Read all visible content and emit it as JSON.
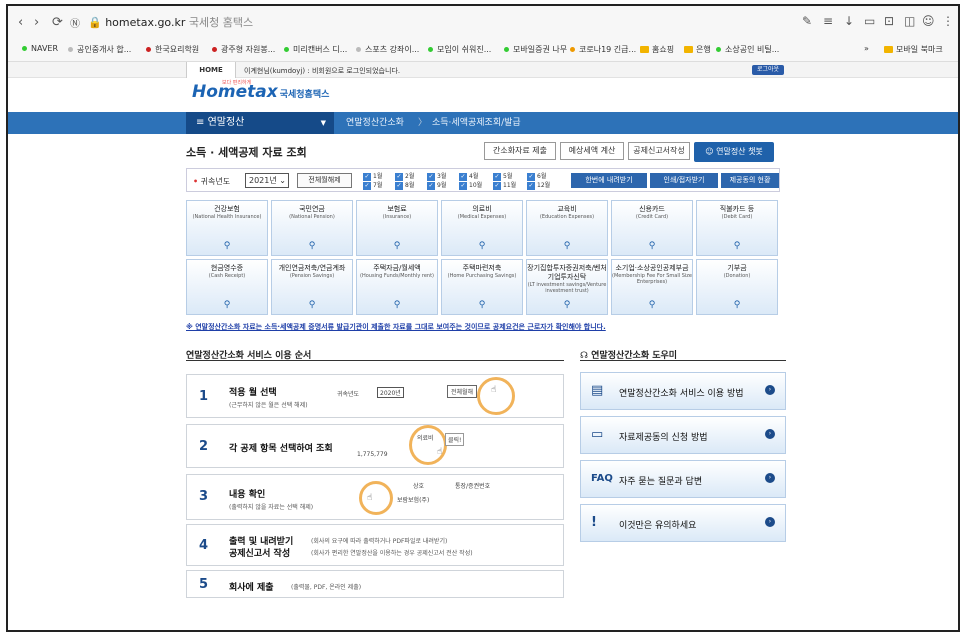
{
  "browser": {
    "url_domain": "hometax.go.kr",
    "url_title": "국세청 홈택스",
    "bookmarks": [
      "NAVER",
      "공인중개사 합...",
      "한국요리학원",
      "광주형 자원봉...",
      "미리캔버스 디...",
      "스포츠 강좌이...",
      "모임이 쉬워진...",
      "모바일증권 나무",
      "코로나19 긴급...",
      "홈쇼핑",
      "은행",
      "소상공인 비틸..."
    ],
    "bookmark_more": "»",
    "mobile_bookmarks": "모바일 북마크"
  },
  "site": {
    "home": "HOME",
    "greeting": "이계현님(kumdoyj) : 비회원으로 로그인되었습니다.",
    "logout": "로그아웃",
    "logo": "Hometax",
    "logo_sub": "국세청홈택스",
    "logo_small": "보다 편리하게"
  },
  "menu": {
    "main": "연말정산",
    "items": [
      "연말정산간소화",
      "소득·세액공제조회/발급"
    ]
  },
  "title": "소득 · 세액공제 자료 조회",
  "top_buttons": [
    "간소화자료 제출",
    "예상세액 계산",
    "공제신고서작성"
  ],
  "chat_button": "연말정산 챗봇",
  "year_bar": {
    "label": "귀속년도",
    "year": "2021년",
    "toggle": "전체월해제",
    "months": [
      "1월",
      "2월",
      "3월",
      "4월",
      "5월",
      "6월",
      "7월",
      "8월",
      "9월",
      "10월",
      "11월",
      "12월"
    ],
    "buttons": [
      "한번에 내려받기",
      "인쇄/접자받기",
      "제공동의 현황"
    ]
  },
  "categories": [
    {
      "name": "건강보험",
      "en": "(National Health Insurance)"
    },
    {
      "name": "국민연금",
      "en": "(National Pension)"
    },
    {
      "name": "보험료",
      "en": "(Insurance)"
    },
    {
      "name": "의료비",
      "en": "(Medical Expenses)"
    },
    {
      "name": "교육비",
      "en": "(Education Expenses)"
    },
    {
      "name": "신용카드",
      "en": "(Credit Card)"
    },
    {
      "name": "직불카드 등",
      "en": "(Debit Card)"
    },
    {
      "name": "현금영수증",
      "en": "(Cash Receipt)"
    },
    {
      "name": "개인연금저축/연금계좌",
      "en": "(Pension Savings)"
    },
    {
      "name": "주택자금/월세액",
      "en": "(Housing Funds/Monthly rent)"
    },
    {
      "name": "주택마련저축",
      "en": "(Home Purchasing Savings)"
    },
    {
      "name": "장기집합투자증권저축/벤처기업투자신탁",
      "en": "(LT investment savings/Venture investment trust)"
    },
    {
      "name": "소기업·소상공인공제부금",
      "en": "(Membership Fee For Small Size Enterprises)"
    },
    {
      "name": "기부금",
      "en": "(Donation)"
    }
  ],
  "notice": "※ 연말정산간소화 자료는 소득·세액공제 증명서류 발급기관이 제출한 자료를 그대로 보여주는 것이므로 공제요건은 근로자가 확인해야 합니다.",
  "usage_title": "연말정산간소화 서비스 이용 순서",
  "steps": [
    {
      "n": "1",
      "title": "적용 월 선택",
      "sub": "(근무하지 않은 월은 선택 해제)"
    },
    {
      "n": "2",
      "title": "각 공제 항목 선택하여 조회",
      "sub": ""
    },
    {
      "n": "3",
      "title": "내용 확인",
      "sub": "(출력하지 않을 자료는 선택 해제)"
    },
    {
      "n": "4",
      "title": "출력 및 내려받기",
      "title2": "공제신고서 작성",
      "sub": "(회사의 요구에 따라 출력하거나 PDF파일로 내려받기)",
      "sub2": "(회사가 편리한 연말정산을 이용하는 경우 공제신고서 전산 작성)"
    },
    {
      "n": "5",
      "title": "회사에 제출",
      "sub": "(출력물, PDF, 온라인 제출)"
    }
  ],
  "step_thumbs": {
    "year_label": "귀속년도",
    "year": "2020년",
    "toggle": "전체월해",
    "medical": "의료비",
    "click": "클릭!",
    "amount": "1,775,779",
    "hdr1": "상호",
    "hdr2": "통장/증권번호",
    "row": "보람보험(주)"
  },
  "helper_title": "연말정산간소화 도우미",
  "helpers": [
    {
      "icon": "document-icon",
      "label": "연말정산간소화 서비스 이용 방법"
    },
    {
      "icon": "consent-icon",
      "label": "자료제공동의 신청 방법"
    },
    {
      "icon": "faq-icon",
      "label": "자주 묻는 질문과 답변"
    },
    {
      "icon": "caution-icon",
      "label": "이것만은 유의하세요"
    }
  ]
}
